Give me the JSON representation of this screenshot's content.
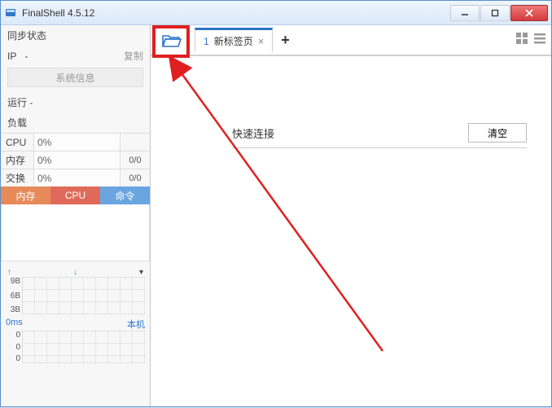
{
  "titlebar": {
    "title": "FinalShell 4.5.12"
  },
  "sidebar": {
    "sync_label": "同步状态",
    "ip_label": "IP",
    "ip_value": "-",
    "copy_label": "复制",
    "sysinfo_btn": "系统信息",
    "run_label": "运行",
    "run_value": "-",
    "load_label": "负载",
    "metrics": {
      "cpu": {
        "label": "CPU",
        "value": "0%"
      },
      "mem": {
        "label": "内存",
        "value": "0%",
        "extra": "0/0"
      },
      "swap": {
        "label": "交换",
        "value": "0%",
        "extra": "0/0"
      }
    },
    "mini_tabs": {
      "mem": "内存",
      "cpu": "CPU",
      "cmd": "命令"
    },
    "net_y": [
      "9B",
      "6B",
      "3B"
    ],
    "latency": {
      "ms": "0ms",
      "host": "本机",
      "y": [
        "0",
        "0",
        "0"
      ]
    },
    "arrows": {
      "up": "↑",
      "down": "↓",
      "menu": "▾"
    }
  },
  "content": {
    "tab": {
      "num": "1",
      "label": "新标签页",
      "close": "×"
    },
    "add": "+",
    "quick_connect": "快速连接",
    "clear_btn": "清空"
  }
}
